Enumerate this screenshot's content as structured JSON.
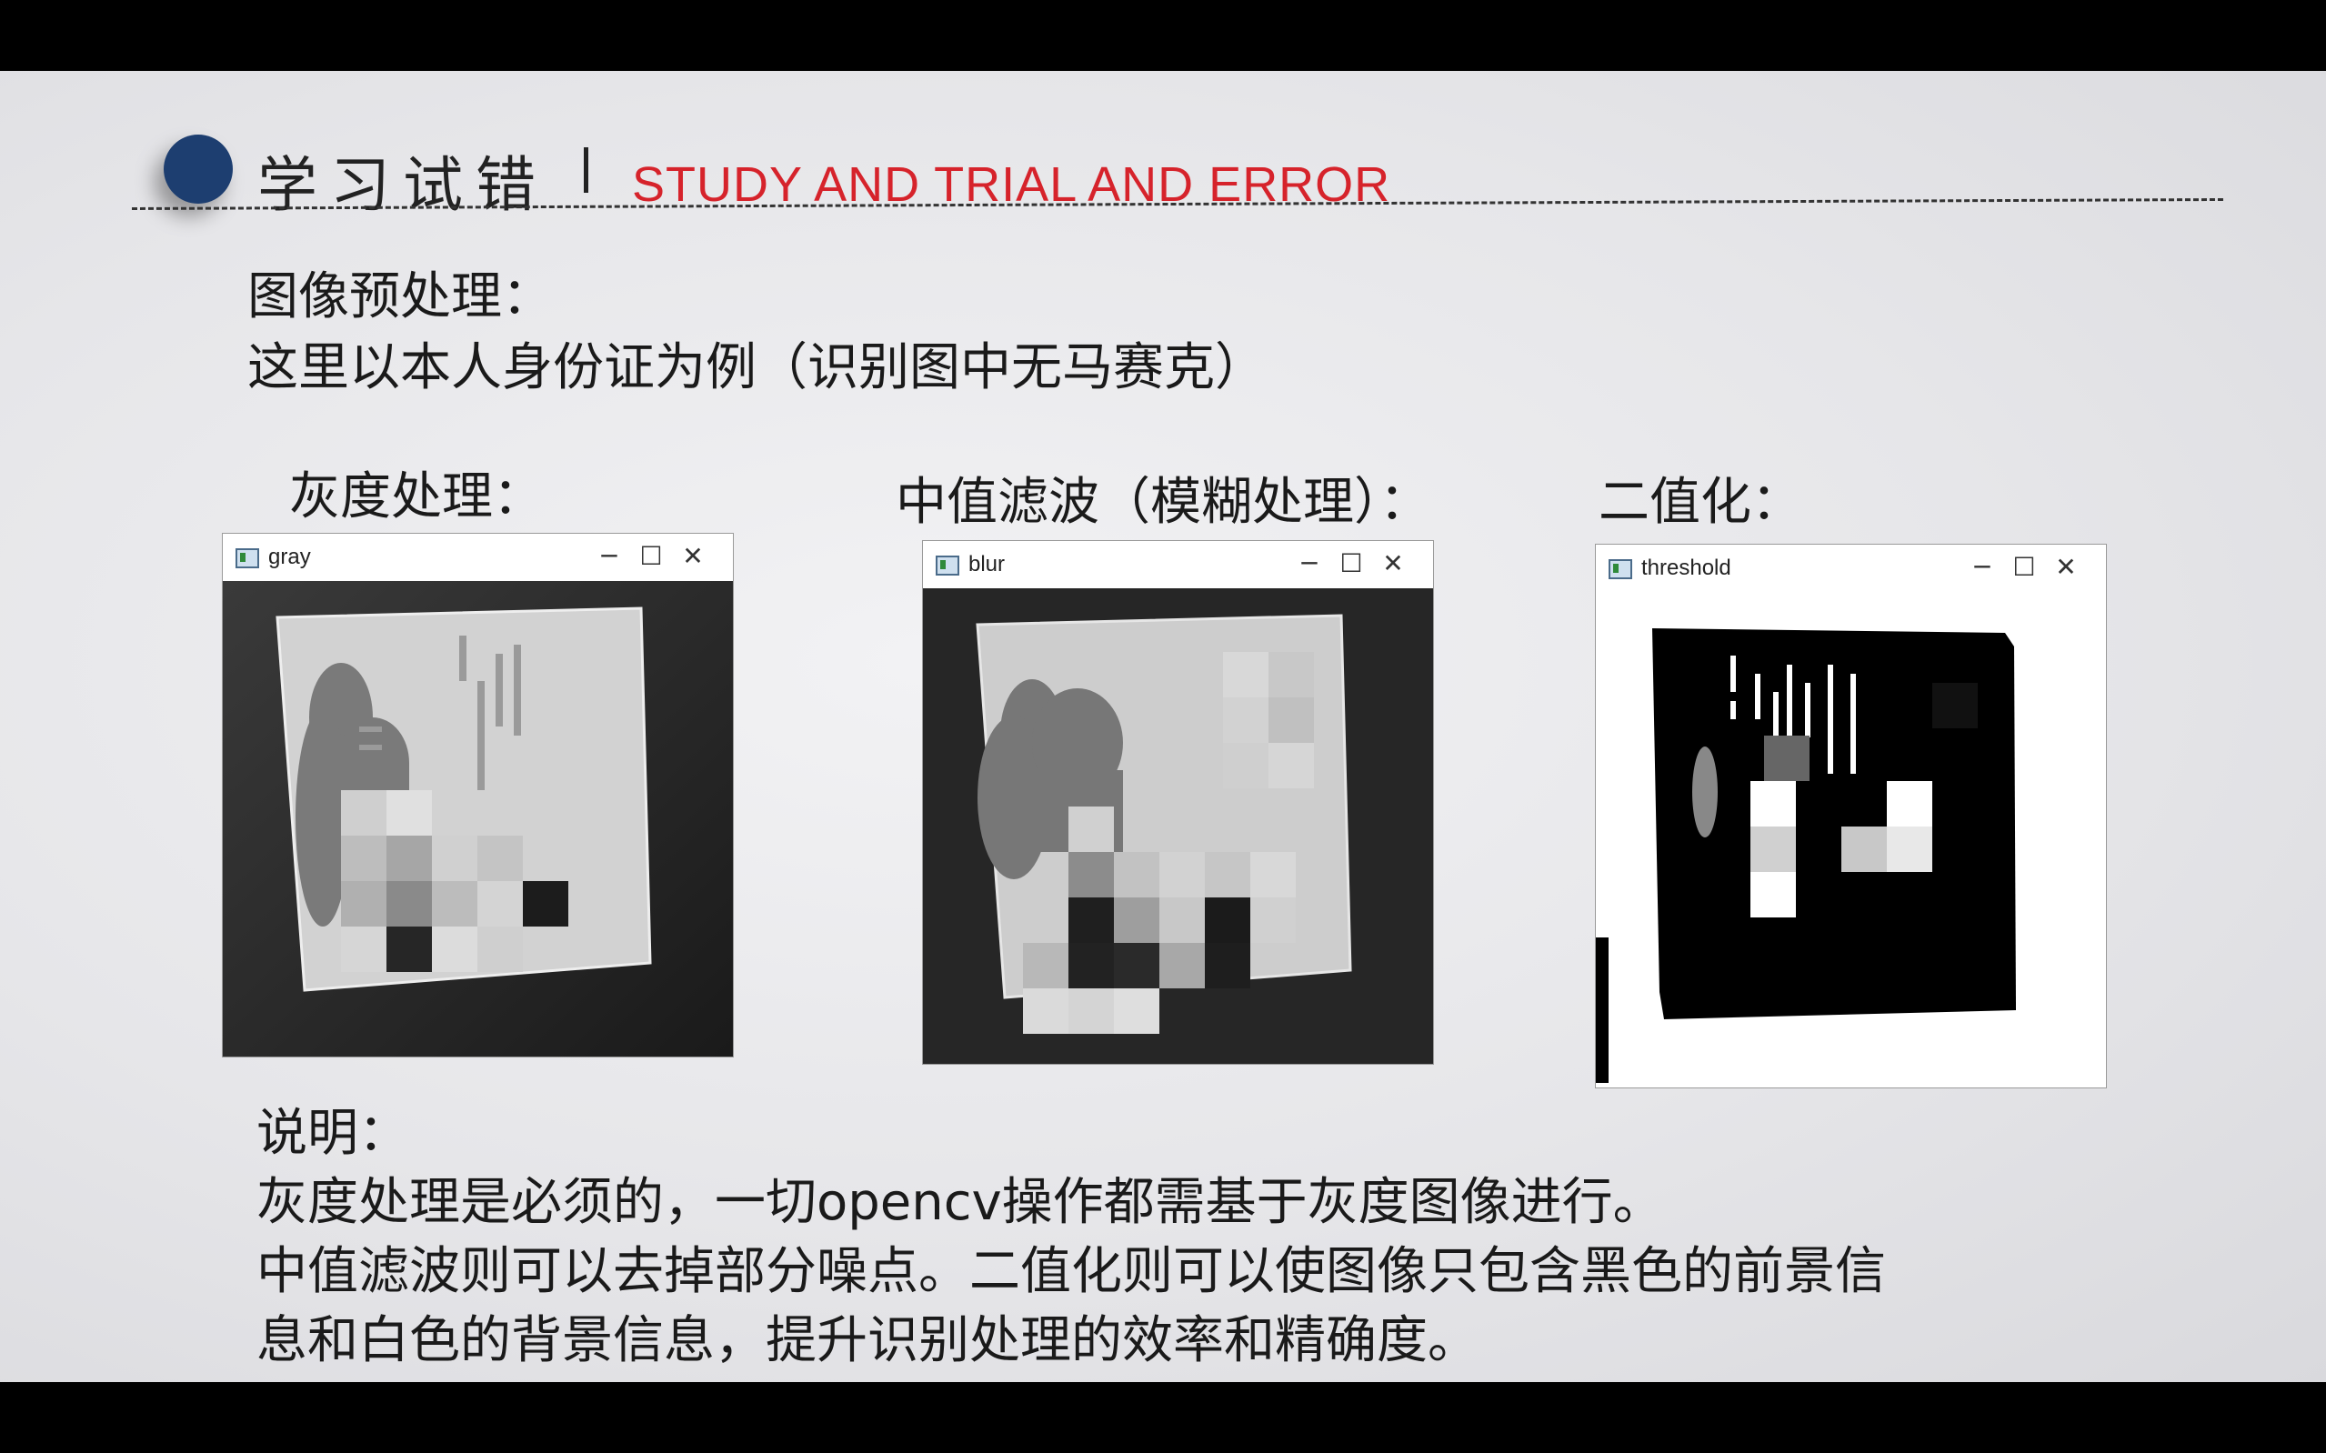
{
  "header": {
    "title_cn": "学习试错",
    "title_en": "STUDY AND TRIAL AND ERROR"
  },
  "intro": {
    "line1": "图像预处理：",
    "line2": "这里以本人身份证为例（识别图中无马赛克）"
  },
  "panels": [
    {
      "label": "灰度处理：",
      "window_title": "gray"
    },
    {
      "label": "中值滤波（模糊处理）：",
      "window_title": "blur"
    },
    {
      "label": "二值化：",
      "window_title": "threshold"
    }
  ],
  "window_controls": {
    "minimize": "─",
    "maximize": "☐",
    "close": "✕"
  },
  "explanation": {
    "heading": "说明：",
    "line1": "灰度处理是必须的，一切opencv操作都需基于灰度图像进行。",
    "line2": "中值滤波则可以去掉部分噪点。二值化则可以使图像只包含黑色的前景信",
    "line3": "息和白色的背景信息，提升识别处理的效率和精确度。"
  },
  "colors": {
    "bullet": "#1d3e70",
    "title_en": "#d6232b"
  }
}
